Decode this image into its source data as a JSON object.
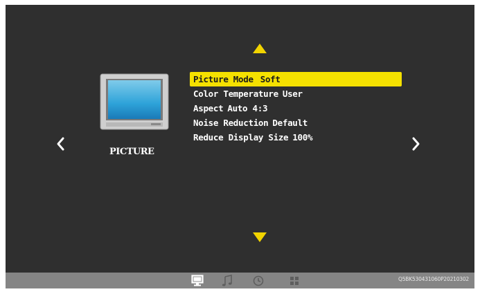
{
  "menu": {
    "category_label": "PICTURE",
    "items": [
      {
        "label": "Picture Mode",
        "value": "Soft"
      },
      {
        "label": "Color Temperature",
        "value": "User"
      },
      {
        "label": "Aspect",
        "value": "Auto 4:3"
      },
      {
        "label": "Noise Reduction",
        "value": "Default"
      },
      {
        "label": "Reduce Display Size",
        "value": "100%"
      }
    ],
    "selected_index": 0
  },
  "bottom_bar": {
    "icons": [
      "picture-icon",
      "music-icon",
      "clock-icon",
      "grid-icon"
    ],
    "active_icon": "picture-icon",
    "serial": "Q5BK530431060P20210302"
  },
  "colors": {
    "background": "#2f2f2f",
    "highlight": "#f5e100",
    "arrow": "#f2d400",
    "bottom_bar": "#858585"
  }
}
